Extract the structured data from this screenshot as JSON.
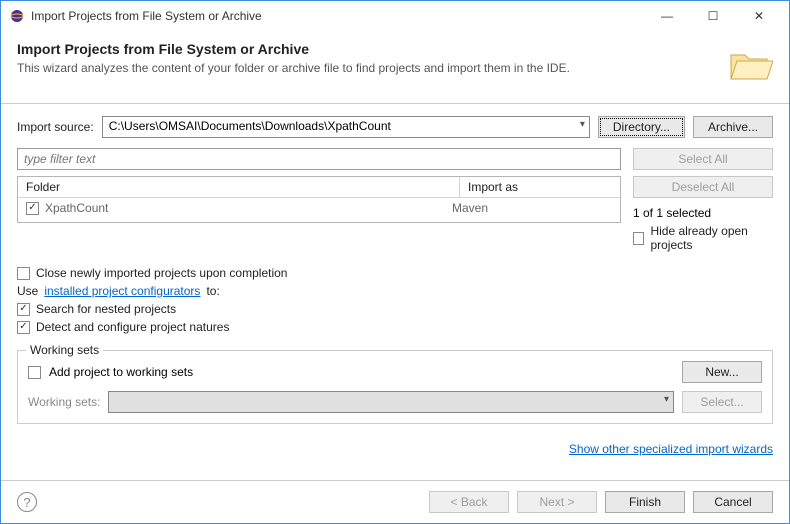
{
  "window": {
    "title": "Import Projects from File System or Archive"
  },
  "header": {
    "title": "Import Projects from File System or Archive",
    "desc": "This wizard analyzes the content of your folder or archive file to find projects and import them in the IDE."
  },
  "source": {
    "label": "Import source:",
    "value": "C:\\Users\\OMSAI\\Documents\\Downloads\\XpathCount",
    "directory_btn": "Directory...",
    "archive_btn": "Archive..."
  },
  "filter": {
    "placeholder": "type filter text"
  },
  "table": {
    "col_folder": "Folder",
    "col_import_as": "Import as",
    "rows": [
      {
        "folder": "XpathCount",
        "import_as": "Maven",
        "checked": true
      }
    ]
  },
  "side": {
    "select_all": "Select All",
    "deselect_all": "Deselect All",
    "selection_status": "1 of 1 selected",
    "hide_open": "Hide already open projects"
  },
  "options": {
    "close_on_complete": "Close newly imported projects upon completion",
    "use_prefix": "Use ",
    "configurators_link": "installed project configurators",
    "use_suffix": " to:",
    "search_nested": "Search for nested projects",
    "detect_natures": "Detect and configure project natures"
  },
  "working_sets": {
    "legend": "Working sets",
    "add": "Add project to working sets",
    "new_btn": "New...",
    "label": "Working sets:",
    "select_btn": "Select..."
  },
  "links": {
    "specialized": "Show other specialized import wizards"
  },
  "footer": {
    "back": "< Back",
    "next": "Next >",
    "finish": "Finish",
    "cancel": "Cancel"
  }
}
